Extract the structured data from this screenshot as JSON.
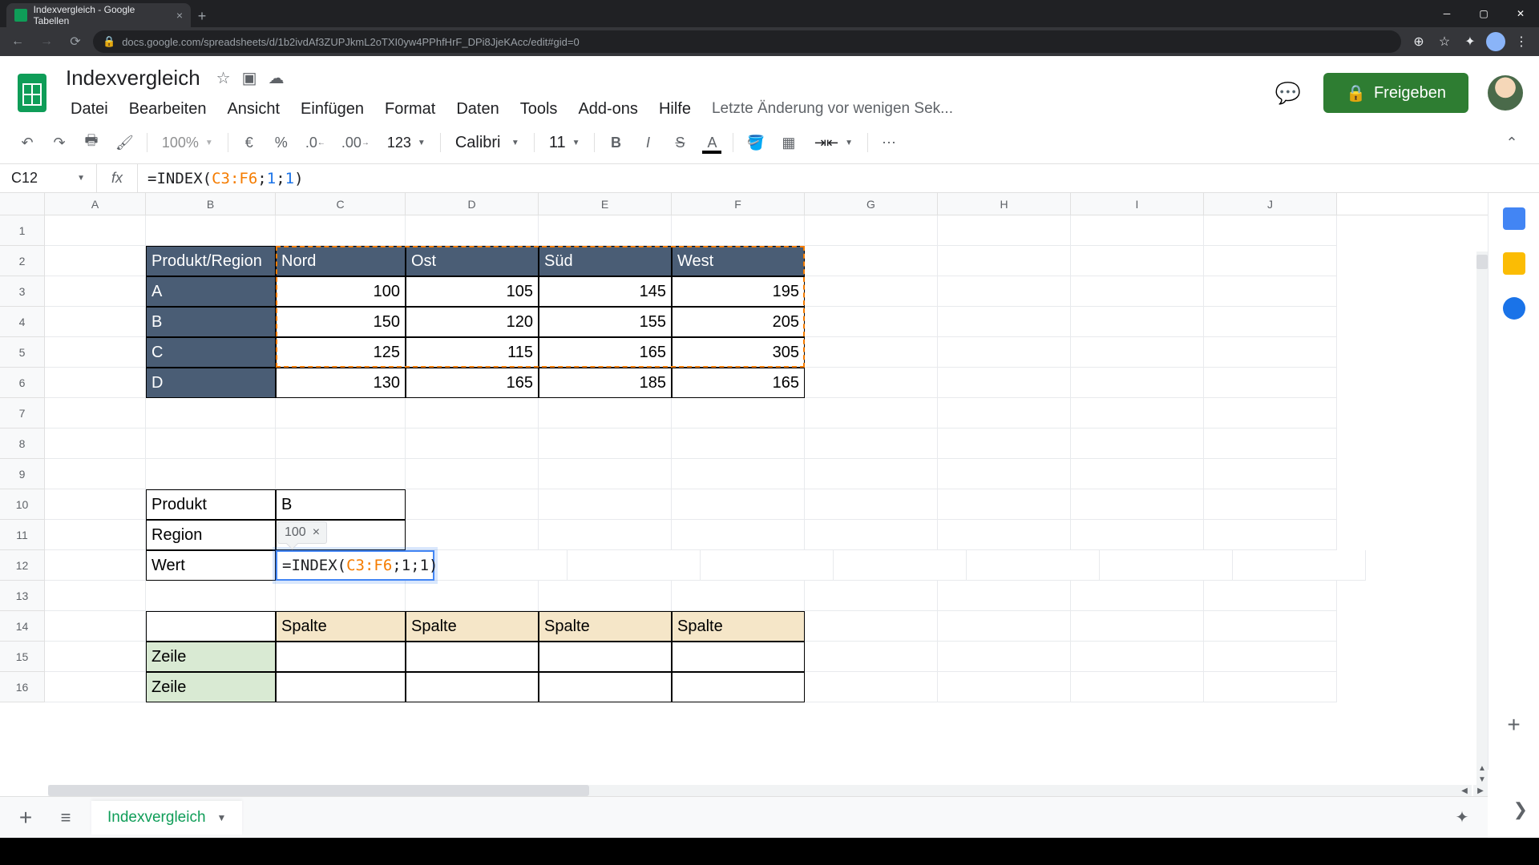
{
  "browser": {
    "tab_title": "Indexvergleich - Google Tabellen",
    "url": "docs.google.com/spreadsheets/d/1b2ivdAf3ZUPJkmL2oTXI0yw4PPhfHrF_DPi8JjeKAcc/edit#gid=0"
  },
  "doc": {
    "title": "Indexvergleich",
    "menus": [
      "Datei",
      "Bearbeiten",
      "Ansicht",
      "Einfügen",
      "Format",
      "Daten",
      "Tools",
      "Add-ons",
      "Hilfe"
    ],
    "last_edit": "Letzte Änderung vor wenigen Sek...",
    "share_label": "Freigeben"
  },
  "toolbar": {
    "zoom": "100%",
    "currency": "€",
    "percent": "%",
    "dec_dec": ".0",
    "dec_inc": ".00",
    "num_format": "123",
    "font": "Calibri",
    "font_size": "11"
  },
  "formula_bar": {
    "cell_ref": "C12",
    "prefix": "=INDEX(",
    "range": "C3:F6",
    "mid": ";",
    "arg1": "1",
    "arg2": "1",
    "suffix": ")"
  },
  "columns": [
    "A",
    "B",
    "C",
    "D",
    "E",
    "F",
    "G",
    "H",
    "I",
    "J"
  ],
  "rows": [
    "1",
    "2",
    "3",
    "4",
    "5",
    "6",
    "7",
    "8",
    "9",
    "10",
    "11",
    "12",
    "13",
    "14",
    "15",
    "16"
  ],
  "table": {
    "corner": "Produkt/Region",
    "col_headers": [
      "Nord",
      "Ost",
      "Süd",
      "West"
    ],
    "row_headers": [
      "A",
      "B",
      "C",
      "D"
    ],
    "data": [
      [
        100,
        105,
        145,
        195
      ],
      [
        150,
        120,
        155,
        205
      ],
      [
        125,
        115,
        165,
        305
      ],
      [
        130,
        165,
        185,
        165
      ]
    ]
  },
  "lookup": {
    "produkt_label": "Produkt",
    "produkt_value": "B",
    "region_label": "Region",
    "wert_label": "Wert",
    "preview_value": "100"
  },
  "cell_edit": {
    "prefix": "=INDEX(",
    "range": "C3:F6",
    "rest": ";1;1)"
  },
  "aux": {
    "spalte": "Spalte",
    "zeile": "Zeile"
  },
  "sheet_tab": "Indexvergleich"
}
